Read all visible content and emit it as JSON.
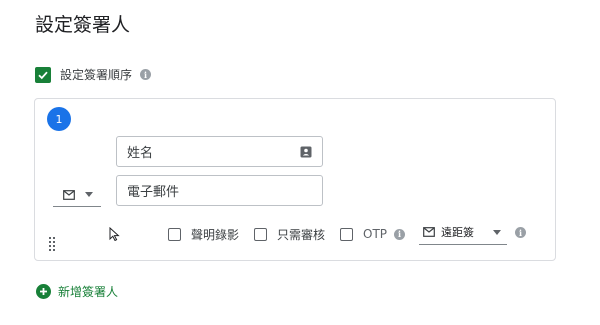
{
  "page": {
    "title": "設定簽署人"
  },
  "signing_order": {
    "label": "設定簽署順序",
    "checked": true,
    "info_icon": "i"
  },
  "signer": {
    "number": "1",
    "name_placeholder": "姓名",
    "email_placeholder": "電子郵件",
    "delivery_icon": "mail-icon",
    "options": {
      "record_label": "聲明錄影",
      "review_only_label": "只需審核",
      "otp_label": "OTP"
    },
    "sign_method": {
      "label": "遠距簽",
      "icon": "mail-icon"
    }
  },
  "actions": {
    "add_signer_label": "新增簽署人"
  },
  "colors": {
    "accent_green": "#188038",
    "badge_blue": "#1a73e8"
  }
}
